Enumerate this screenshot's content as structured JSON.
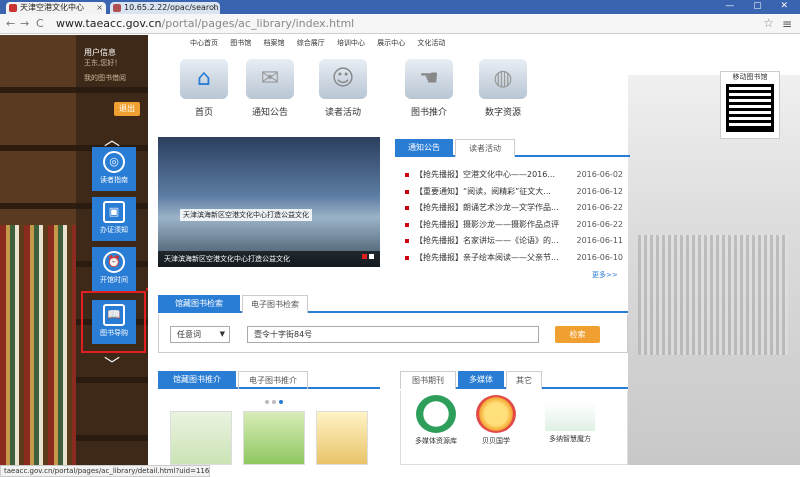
{
  "browser": {
    "tabs": [
      {
        "title": "天津空港文化中心"
      },
      {
        "title": "10.65.2.22/opac/search"
      }
    ],
    "window_controls": "— ▢ ✕",
    "url_host": "www.taeacc.gov.cn",
    "url_path": "/portal/pages/ac_library/index.html",
    "back_glyph": "←",
    "forward_glyph": "→",
    "reload_glyph": "C",
    "status_url": "taeacc.gov.cn/portal/pages/ac_library/detail.html?uid=116"
  },
  "sidebar": {
    "user_title": "用户信息",
    "user_greeting": "王东,您好！",
    "user_link": "我的图书借阅",
    "logout_label": "退出",
    "items": [
      {
        "label": "读者指南",
        "icon": "◎"
      },
      {
        "label": "办证须知",
        "icon": "▣"
      },
      {
        "label": "开馆时间",
        "icon": "⏰"
      },
      {
        "label": "图书导购",
        "icon": "📖"
      }
    ]
  },
  "topnav": [
    "中心首页",
    "图书馆",
    "档案馆",
    "综合展厅",
    "培训中心",
    "展示中心",
    "文化活动"
  ],
  "categories": [
    {
      "label": "首页",
      "icon": "⌂"
    },
    {
      "label": "通知公告",
      "icon": "✉"
    },
    {
      "label": "读者活动",
      "icon": "☺"
    },
    {
      "label": "图书推介",
      "icon": "☚"
    },
    {
      "label": "数字资源",
      "icon": "◍"
    }
  ],
  "qr_label": "移动图书馆",
  "banner": {
    "caption_inner": "天津滨海新区空港文化中心打造公益文化",
    "caption_bottom": "天津滨海新区空港文化中心打造公益文化"
  },
  "notice_tabs": {
    "active": "通知公告",
    "inactive": "读者活动"
  },
  "news": [
    {
      "title": "【抢先播报】空港文化中心——2016...",
      "date": "2016-06-02"
    },
    {
      "title": "【重要通知】“阅读，阅精彩”征文大...",
      "date": "2016-06-12"
    },
    {
      "title": "【抢先播报】朗诵艺术沙龙—文学作品...",
      "date": "2016-06-22"
    },
    {
      "title": "【抢先播报】摄影沙龙——摄影作品点评",
      "date": "2016-06-22"
    },
    {
      "title": "【抢先播报】名家讲坛——《论语》的...",
      "date": "2016-06-11"
    },
    {
      "title": "【抢先播报】亲子绘本阅读——父亲节...",
      "date": "2016-06-10"
    }
  ],
  "more_label": "更多>>",
  "search": {
    "tab_active": "馆藏图书检索",
    "tab_inactive": "电子图书检索",
    "select_value": "任意词",
    "query": "壹令十字街84号",
    "button": "检索"
  },
  "recommend_tabs": {
    "active": "馆藏图书推介",
    "inactive": "电子图书推介"
  },
  "media_tabs": {
    "first": "图书期刊",
    "active": "多媒体",
    "third": "其它"
  },
  "media_items": [
    {
      "label": "多媒体资源库"
    },
    {
      "label": "贝贝国学"
    },
    {
      "label": "多纳智慧魔方"
    }
  ]
}
